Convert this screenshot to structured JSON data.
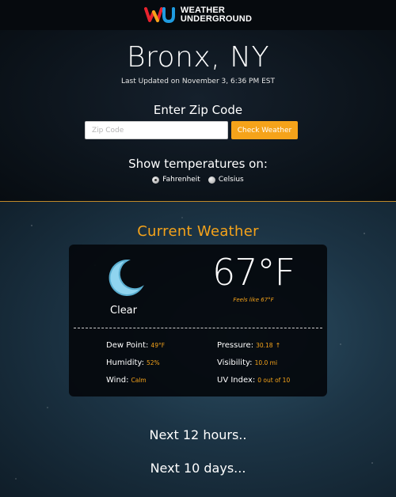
{
  "header": {
    "logo_line1": "WEATHER",
    "logo_line2": "UNDERGROUND",
    "logo_colors": [
      "#e8232e",
      "#f5a31a",
      "#1f9be0"
    ]
  },
  "location": {
    "city": "Bronx, NY",
    "updated": "Last Updated on November 3, 6:36 PM EST"
  },
  "zip": {
    "label": "Enter Zip Code",
    "placeholder": "Zip Code",
    "value": "",
    "button_label": "Check Weather"
  },
  "units": {
    "label": "Show temperatures on:",
    "options": [
      {
        "label": "Fahrenheit",
        "checked": true
      },
      {
        "label": "Celsius",
        "checked": false
      }
    ]
  },
  "current": {
    "title": "Current Weather",
    "icon": "moon-icon",
    "condition": "Clear",
    "temperature": "67°F",
    "feels_like": "Feels like 67°F",
    "stats": {
      "dew_point": {
        "label": "Dew Point:",
        "value": "49°F"
      },
      "humidity": {
        "label": "Humidity:",
        "value": "52%"
      },
      "wind": {
        "label": "Wind:",
        "value": "Calm"
      },
      "pressure": {
        "label": "Pressure:",
        "value": "30.18",
        "trend": "rising"
      },
      "visibility": {
        "label": "Visibility:",
        "value": "10.0 mi"
      },
      "uv_index": {
        "label": "UV Index:",
        "value": "0 out of 10"
      }
    }
  },
  "links": {
    "next_hours": "Next 12 hours..",
    "next_days": "Next 10 days..."
  },
  "colors": {
    "accent": "#f5a31a",
    "moon": "#8fd4ef"
  }
}
